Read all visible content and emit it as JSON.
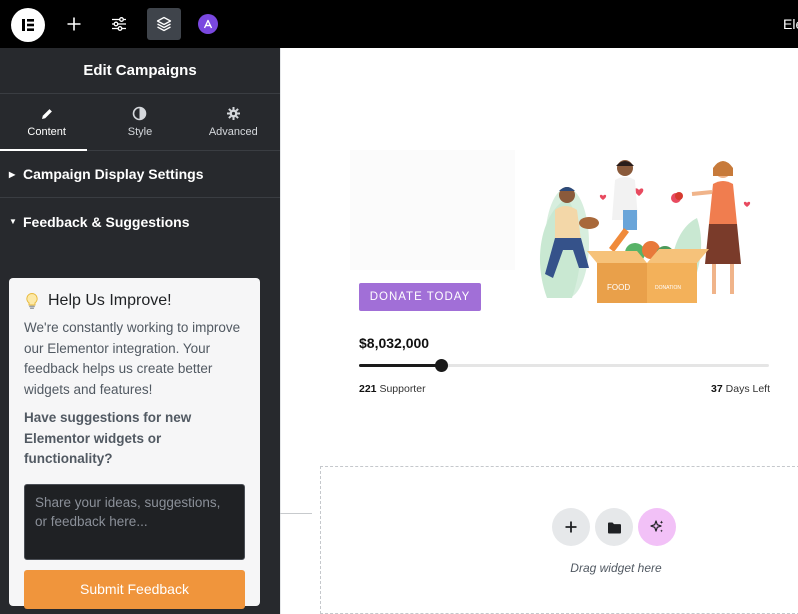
{
  "topbar": {
    "logo_letter": "E",
    "icons": [
      "add-icon",
      "settings-icon",
      "layers-icon",
      "avatar-icon"
    ],
    "right_text": "Ele"
  },
  "panel": {
    "title": "Edit Campaigns",
    "tabs": [
      {
        "label": "Content",
        "icon": "pencil-icon",
        "active": true
      },
      {
        "label": "Style",
        "icon": "contrast-icon",
        "active": false
      },
      {
        "label": "Advanced",
        "icon": "gear-icon",
        "active": false
      }
    ],
    "sections": [
      {
        "label": "Campaign Display Settings",
        "open": false
      },
      {
        "label": "Feedback & Suggestions",
        "open": true
      }
    ],
    "feedback": {
      "title": "Help Us Improve!",
      "icon": "lightbulb-icon",
      "description": "We're constantly working to improve our Elementor integration. Your feedback helps us create better widgets and features!",
      "question": "Have suggestions for new Elementor widgets or functionality?",
      "placeholder": "Share your ideas, suggestions, or feedback here...",
      "submit_label": "Submit Feedback"
    }
  },
  "campaign": {
    "cta_label": "DONATE TODAY",
    "amount": "$8,032,000",
    "progress": 0.2,
    "supporters_count": "221",
    "supporters_label": "Supporter",
    "days_left_count": "37",
    "days_left_label": "Days Left",
    "box_labels": [
      "FOOD",
      "DONATION"
    ]
  },
  "dropzone": {
    "hint": "Drag widget here",
    "buttons": [
      "add-icon",
      "folder-icon",
      "ai-sparkle-icon"
    ]
  },
  "colors": {
    "panel_bg": "#27292d",
    "accent_orange": "#f0953c",
    "donate_purple": "#a16fd7",
    "ai_pink": "#f2c1f7"
  }
}
